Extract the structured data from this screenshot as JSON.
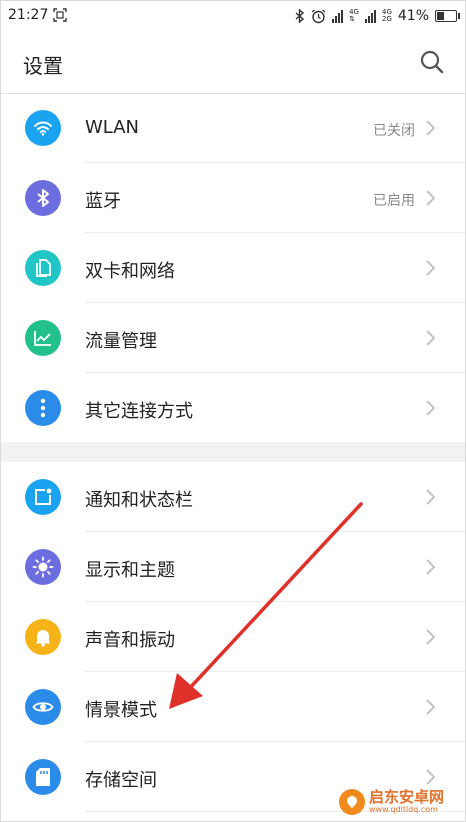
{
  "status_bar": {
    "time": "21:27",
    "net_top": "4G",
    "net_bottom": "2G",
    "battery": "41%",
    "battery_level": 0.41
  },
  "header": {
    "title": "设置"
  },
  "group1": [
    {
      "label": "WLAN",
      "value": "已关闭",
      "icon": "wifi-icon",
      "color": "#1aa3f0"
    },
    {
      "label": "蓝牙",
      "value": "已启用",
      "icon": "bluetooth-icon",
      "color": "#6c6ee0"
    },
    {
      "label": "双卡和网络",
      "value": "",
      "icon": "sim-icon",
      "color": "#21c5c5"
    },
    {
      "label": "流量管理",
      "value": "",
      "icon": "traffic-chart-icon",
      "color": "#22c18b"
    },
    {
      "label": "其它连接方式",
      "value": "",
      "icon": "more-dots-icon",
      "color": "#2b8be8"
    }
  ],
  "group2": [
    {
      "label": "通知和状态栏",
      "value": "",
      "icon": "notification-icon",
      "color": "#1aa3f0"
    },
    {
      "label": "显示和主题",
      "value": "",
      "icon": "brightness-icon",
      "color": "#6c6ee0"
    },
    {
      "label": "声音和振动",
      "value": "",
      "icon": "bell-icon",
      "color": "#f5b318"
    },
    {
      "label": "情景模式",
      "value": "",
      "icon": "eye-icon",
      "color": "#2b8be8"
    },
    {
      "label": "存储空间",
      "value": "",
      "icon": "sd-card-icon",
      "color": "#2b8be8"
    }
  ],
  "watermark": {
    "text": "启东安卓网",
    "url": "www.qdltldq.com"
  },
  "colors": {
    "annotation_arrow": "#e0302a"
  }
}
